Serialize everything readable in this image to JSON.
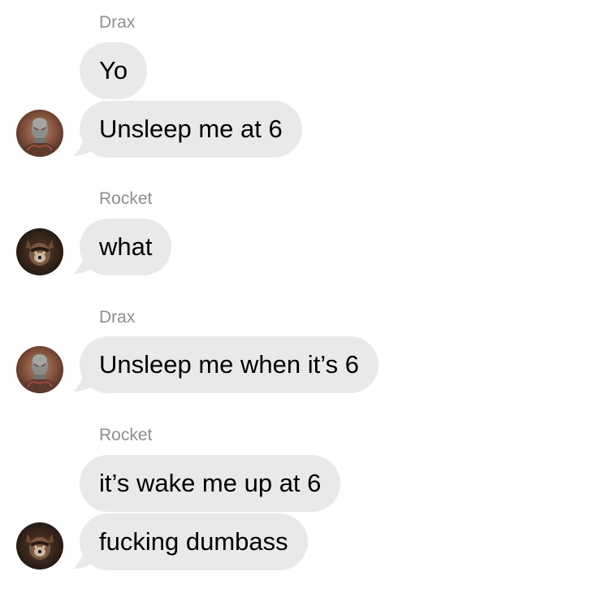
{
  "colors": {
    "bubble_bg": "#e9e9eb",
    "sender_name": "#8e8e93",
    "text": "#000000",
    "background": "#ffffff"
  },
  "conversation": {
    "groups": [
      {
        "sender": "Drax",
        "avatar": "drax-avatar",
        "messages": [
          "Yo",
          "Unsleep me at 6"
        ]
      },
      {
        "sender": "Rocket",
        "avatar": "rocket-avatar",
        "messages": [
          "what"
        ]
      },
      {
        "sender": "Drax",
        "avatar": "drax-avatar",
        "messages": [
          "Unsleep me when it’s 6"
        ]
      },
      {
        "sender": "Rocket",
        "avatar": "rocket-avatar",
        "messages": [
          "it’s wake me up at 6",
          "fucking dumbass"
        ]
      }
    ]
  }
}
